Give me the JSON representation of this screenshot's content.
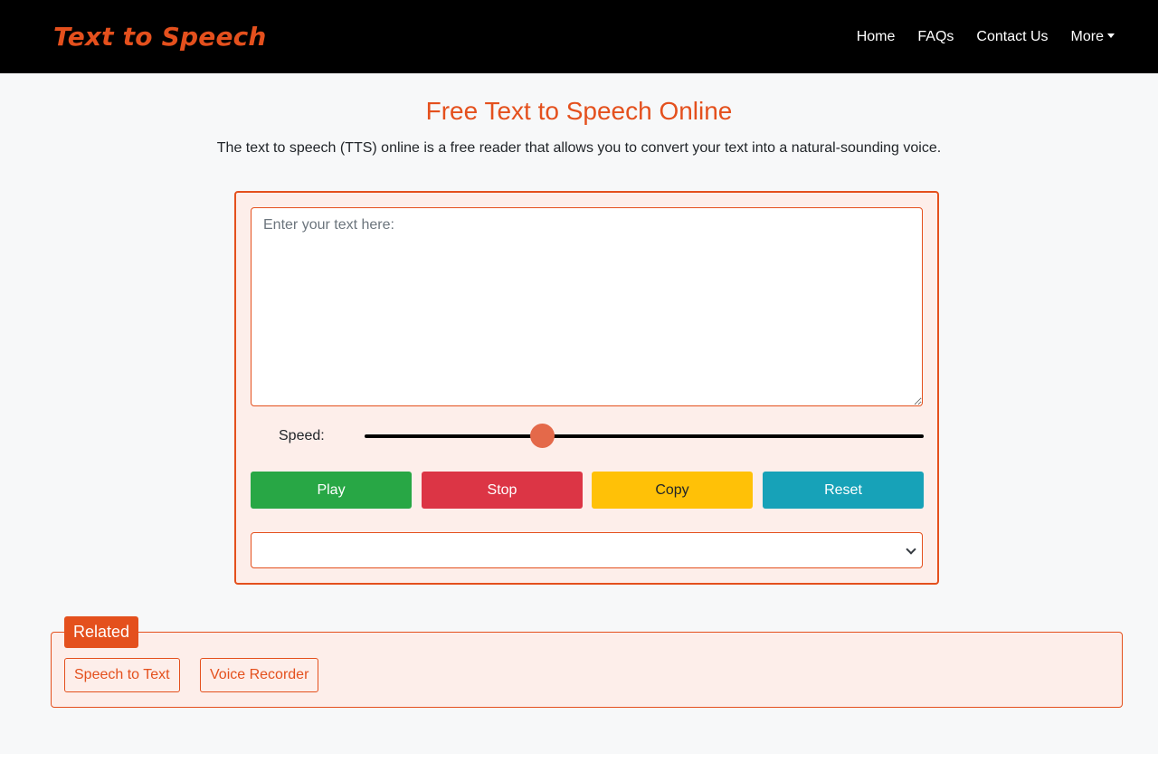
{
  "header": {
    "brand": "Text to Speech",
    "nav": [
      {
        "label": "Home"
      },
      {
        "label": "FAQs"
      },
      {
        "label": "Contact Us"
      },
      {
        "label": "More"
      }
    ]
  },
  "main": {
    "title": "Free Text to Speech Online",
    "subtitle": "The text to speech (TTS) online is a free reader that allows you to convert your text into a natural-sounding voice."
  },
  "tts": {
    "text_value": "",
    "text_placeholder": "Enter your text here:",
    "speed_label": "Speed:",
    "speed_fraction": 0.317,
    "buttons": {
      "play": "Play",
      "stop": "Stop",
      "copy": "Copy",
      "reset": "Reset"
    },
    "voice_selected": ""
  },
  "related": {
    "label": "Related",
    "links": [
      {
        "label": "Speech to Text"
      },
      {
        "label": "Voice Recorder"
      }
    ]
  },
  "colors": {
    "accent": "#e4501d",
    "play": "#28a745",
    "stop": "#dc3545",
    "copy": "#ffc107",
    "reset": "#17a2b8",
    "card_bg": "#fdeeea"
  },
  "icons": {
    "more_caret": "caret-down-icon",
    "select_chevron": "chevron-down-icon"
  }
}
